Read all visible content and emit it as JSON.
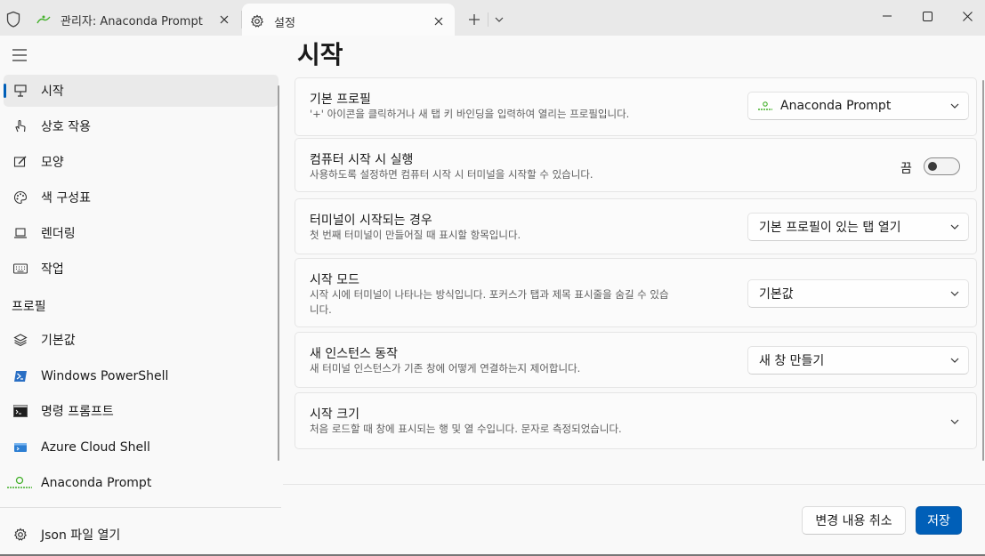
{
  "titlebar": {
    "tabs": [
      {
        "label": "관리자: Anaconda Prompt",
        "icon": "anaconda-icon"
      },
      {
        "label": "설정",
        "icon": "gear-icon",
        "active": true
      }
    ],
    "new_tab": "+",
    "window_buttons": [
      "minimize-icon",
      "maximize-icon",
      "close-icon"
    ]
  },
  "sidebar": {
    "items": [
      {
        "label": "시작",
        "icon": "rocket-icon",
        "active": true
      },
      {
        "label": "상호 작용",
        "icon": "hand-pointer-icon"
      },
      {
        "label": "모양",
        "icon": "paint-icon"
      },
      {
        "label": "색 구성표",
        "icon": "palette-icon"
      },
      {
        "label": "렌더링",
        "icon": "monitor-icon"
      },
      {
        "label": "작업",
        "icon": "keyboard-icon"
      }
    ],
    "profiles_header": "프로필",
    "profiles": [
      {
        "label": "기본값",
        "icon": "layers-icon"
      },
      {
        "label": "Windows PowerShell",
        "icon": "powershell-icon"
      },
      {
        "label": "명령 프롬프트",
        "icon": "cmd-icon"
      },
      {
        "label": "Azure Cloud Shell",
        "icon": "azure-icon"
      },
      {
        "label": "Anaconda Prompt",
        "icon": "anaconda-icon"
      }
    ],
    "footer": {
      "label": "Json 파일 열기",
      "icon": "gear-icon"
    }
  },
  "main": {
    "title": "시작",
    "settings": [
      {
        "title": "기본 프로필",
        "desc": "'+' 아이콘을 클릭하거나 새 탭 키 바인딩을 입력하여 열리는 프로필입니다.",
        "value": "Anaconda Prompt"
      },
      {
        "title": "컴퓨터 시작 시 실행",
        "desc": "사용하도록 설정하면 컴퓨터 시작 시 터미널을 시작할 수 있습니다.",
        "toggle_label": "끔",
        "toggle_on": false
      },
      {
        "title": "터미널이 시작되는 경우",
        "desc": "첫 번째 터미널이 만들어질 때 표시할 항목입니다.",
        "value": "기본 프로필이 있는 탭 열기"
      },
      {
        "title": "시작 모드",
        "desc_line1": "시작 시에 터미널이 나타나는 방식입니다. 포커스가 탭과 제목 표시줄을 숨길 수 있습",
        "desc_line2": "니다.",
        "value": "기본값"
      },
      {
        "title": "새 인스턴스 동작",
        "desc": "새 터미널 인스턴스가 기존 창에 어떻게 연결하는지 제어합니다.",
        "value": "새 창 만들기"
      },
      {
        "title": "시작 크기",
        "desc": "처음 로드할 때 창에 표시되는 행 및 열 수입니다. 문자로 측정되었습니다."
      }
    ],
    "buttons": {
      "cancel": "변경 내용 취소",
      "save": "저장"
    }
  },
  "colors": {
    "accent": "#005fb8",
    "anaconda": "#43b02a"
  }
}
